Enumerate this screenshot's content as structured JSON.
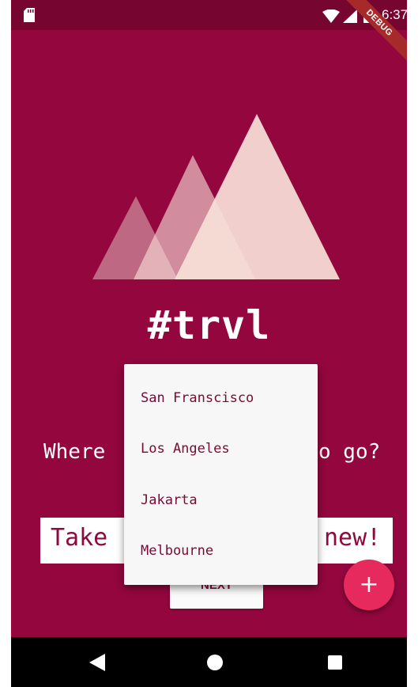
{
  "status_bar": {
    "time": "6:37",
    "debug_label": "DEBUG",
    "icons": [
      "sd-card-icon",
      "wifi-icon",
      "signal-icon",
      "battery-charging-icon"
    ]
  },
  "app": {
    "title": "#trvl",
    "question_visible_left": "Where",
    "question_visible_right": "o go?",
    "input_visible_left": "Take",
    "input_visible_right": "new!",
    "next_label": "NEXT",
    "fab_label": "+"
  },
  "dropdown": {
    "options": [
      "San Franscisco",
      "Los Angeles",
      "Jakarta",
      "Melbourne"
    ]
  },
  "nav": {
    "icons": [
      "back-icon",
      "home-icon",
      "recents-icon"
    ]
  },
  "colors": {
    "background": "#93073e",
    "status_bar": "#76052f",
    "accent_fab": "#e72a5e",
    "text_on_white": "#8c0a3d",
    "mountain_light": "#f7e1d9"
  }
}
